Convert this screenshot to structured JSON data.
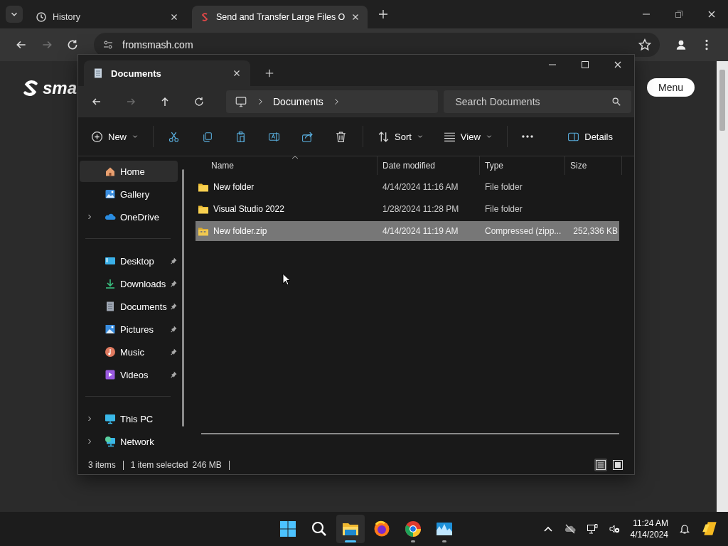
{
  "browser": {
    "tabs": [
      {
        "kind": "history",
        "title": "History",
        "selected": false
      },
      {
        "kind": "site",
        "title": "Send and Transfer Large Files O",
        "selected": true
      }
    ],
    "nav": [
      {
        "kind": "back",
        "disabled": false
      },
      {
        "kind": "forward",
        "disabled": true
      },
      {
        "kind": "reload",
        "disabled": false
      }
    ],
    "url": "fromsmash.com",
    "page": {
      "logo_text": "sma",
      "menu_button": "Menu"
    }
  },
  "explorer": {
    "tab_title": "Documents",
    "nav": [
      {
        "kind": "back",
        "disabled": false
      },
      {
        "kind": "forward",
        "disabled": true
      },
      {
        "kind": "up",
        "disabled": false
      },
      {
        "kind": "refresh",
        "disabled": false
      }
    ],
    "breadcrumb": [
      "Documents"
    ],
    "search": {
      "placeholder": "Search Documents"
    },
    "commands": [
      {
        "kind": "new",
        "label": "New"
      },
      {
        "kind": "sep"
      },
      {
        "kind": "cut"
      },
      {
        "kind": "copy"
      },
      {
        "kind": "paste"
      },
      {
        "kind": "rename"
      },
      {
        "kind": "share"
      },
      {
        "kind": "delete"
      },
      {
        "kind": "sep"
      },
      {
        "kind": "sort",
        "label": "Sort"
      },
      {
        "kind": "view",
        "label": "View"
      },
      {
        "kind": "sep"
      },
      {
        "kind": "more"
      },
      {
        "kind": "details",
        "label": "Details"
      }
    ],
    "sidebar": [
      {
        "kind": "home",
        "label": "Home",
        "selected": true,
        "pinned": false,
        "expandable": false
      },
      {
        "kind": "gallery",
        "label": "Gallery",
        "selected": false,
        "pinned": false,
        "expandable": false
      },
      {
        "kind": "onedrive",
        "label": "OneDrive",
        "selected": false,
        "pinned": false,
        "expandable": true
      },
      {
        "kind": "sep"
      },
      {
        "kind": "desktop",
        "label": "Desktop",
        "selected": false,
        "pinned": true,
        "expandable": false
      },
      {
        "kind": "downloads",
        "label": "Downloads",
        "selected": false,
        "pinned": true,
        "expandable": false
      },
      {
        "kind": "documents",
        "label": "Documents",
        "selected": false,
        "pinned": true,
        "expandable": false
      },
      {
        "kind": "pictures",
        "label": "Pictures",
        "selected": false,
        "pinned": true,
        "expandable": false
      },
      {
        "kind": "music",
        "label": "Music",
        "selected": false,
        "pinned": true,
        "expandable": false
      },
      {
        "kind": "videos",
        "label": "Videos",
        "selected": false,
        "pinned": true,
        "expandable": false
      },
      {
        "kind": "sep"
      },
      {
        "kind": "pc",
        "label": "This PC",
        "selected": false,
        "pinned": false,
        "expandable": true
      },
      {
        "kind": "network",
        "label": "Network",
        "selected": false,
        "pinned": false,
        "expandable": true
      }
    ],
    "columns": [
      "Name",
      "Date modified",
      "Type",
      "Size"
    ],
    "rows": [
      {
        "kind": "folder",
        "name": "New folder",
        "date": "4/14/2024 11:16 AM",
        "type": "File folder",
        "selected": false
      },
      {
        "kind": "folder",
        "name": "Visual Studio 2022",
        "date": "1/28/2024 11:28 PM",
        "type": "File folder",
        "selected": false
      },
      {
        "kind": "zip",
        "name": "New folder.zip",
        "date": "4/14/2024 11:19 AM",
        "type": "Compressed (zipp...",
        "size": "252,336 KB",
        "selected": true
      }
    ],
    "status": {
      "count": "3 items",
      "selection": "1 item selected",
      "size": "246 MB"
    },
    "views": [
      {
        "kind": "details",
        "selected": true
      },
      {
        "kind": "tiles",
        "selected": false
      }
    ]
  },
  "taskbar": {
    "apps": [
      {
        "kind": "start",
        "running": false,
        "active": false
      },
      {
        "kind": "search",
        "running": false,
        "active": false
      },
      {
        "kind": "explorer",
        "running": true,
        "active": true
      },
      {
        "kind": "firefox",
        "running": false,
        "active": false
      },
      {
        "kind": "chrome",
        "running": true,
        "active": false
      },
      {
        "kind": "photos",
        "running": true,
        "active": false
      }
    ],
    "tray": [
      {
        "kind": "chevron"
      },
      {
        "kind": "cloud"
      },
      {
        "kind": "network"
      },
      {
        "kind": "volume"
      }
    ],
    "time": "11:24 AM",
    "date": "4/14/2024"
  }
}
